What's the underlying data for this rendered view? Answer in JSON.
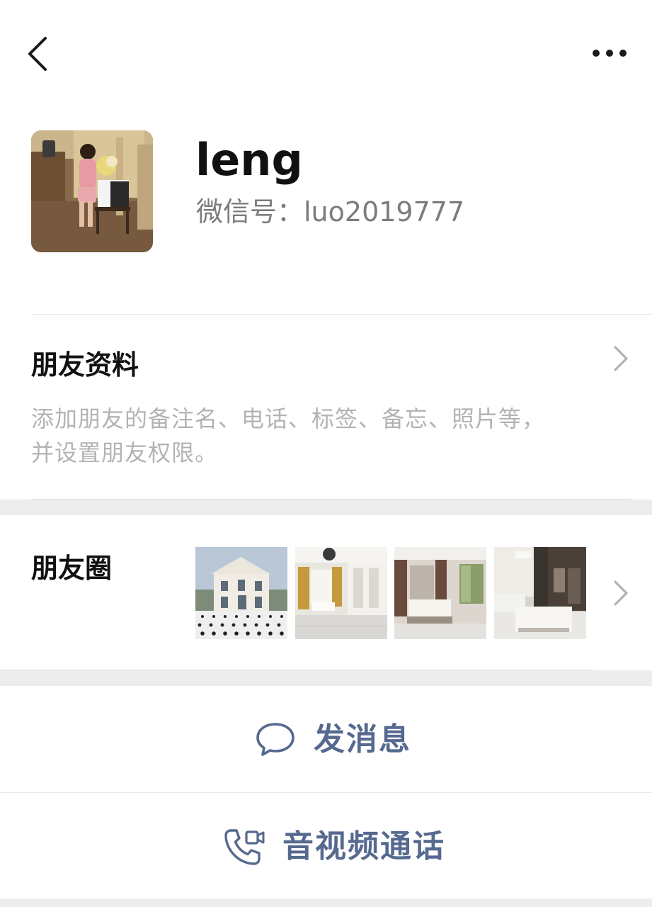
{
  "profile": {
    "nickname": "leng",
    "wechat_id": "微信号：luo2019777"
  },
  "friend_info": {
    "title": "朋友资料",
    "desc_line1": "添加朋友的备注名、电话、标签、备忘、照片等，",
    "desc_line2": "并设置朋友权限。"
  },
  "moments": {
    "title": "朋友圈"
  },
  "actions": {
    "message": "发消息",
    "call": "音视频通话"
  },
  "colors": {
    "accent": "#56698f",
    "hint": "#b3b3b3",
    "separator_band": "#ededed"
  },
  "icons": {
    "back": "chevron-left-icon",
    "more": "more-dots-icon",
    "message": "chat-bubble-icon",
    "call": "video-call-icon",
    "chevron": "chevron-right-icon"
  }
}
